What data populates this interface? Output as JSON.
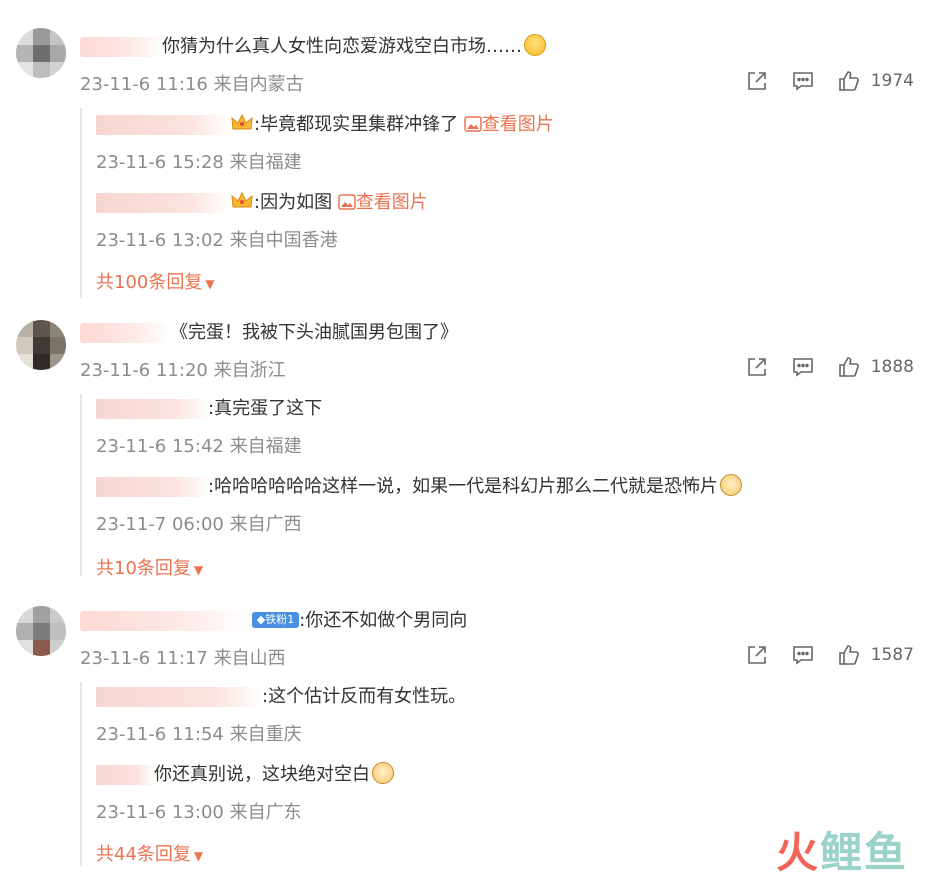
{
  "comments": [
    {
      "text": "你猜为什么真人女性向恋爱游戏空白市场……",
      "meta": "23-11-6 11:16 来自内蒙古",
      "likes": "1974",
      "replies": [
        {
          "text": ":毕竟都现实里集群冲锋了",
          "link": "查看图片",
          "meta": "23-11-6 15:28 来自福建"
        },
        {
          "text": ":因为如图",
          "link": "查看图片",
          "meta": "23-11-6 13:02 来自中国香港"
        }
      ],
      "more": "共100条回复"
    },
    {
      "text": "《完蛋！我被下头油腻国男包围了》",
      "meta": "23-11-6 11:20 来自浙江",
      "likes": "1888",
      "replies": [
        {
          "text": ":真完蛋了这下",
          "meta": "23-11-6 15:42 来自福建"
        },
        {
          "text": ":哈哈哈哈哈哈这样一说，如果一代是科幻片那么二代就是恐怖片",
          "meta": "23-11-7 06:00 来自广西"
        }
      ],
      "more": "共10条回复"
    },
    {
      "badge": "铁粉1",
      "text": ":你还不如做个男同向",
      "meta": "23-11-6 11:17 来自山西",
      "likes": "1587",
      "replies": [
        {
          "text": ":这个估计反而有女性玩。",
          "meta": "23-11-6 11:54 来自重庆"
        },
        {
          "text": "你还真别说，这块绝对空白",
          "meta": "23-11-6 13:00 来自广东"
        }
      ],
      "more": "共44条回复"
    }
  ],
  "icons": {
    "share": "share-icon",
    "comment": "comment-icon",
    "like": "thumbs-up-icon",
    "image": "image-icon"
  },
  "colors": {
    "accent": "#eb7350",
    "meta_text": "#8c8c8c",
    "body_text": "#333333"
  },
  "watermark": {
    "part1": "火",
    "part2": "鲤鱼"
  }
}
